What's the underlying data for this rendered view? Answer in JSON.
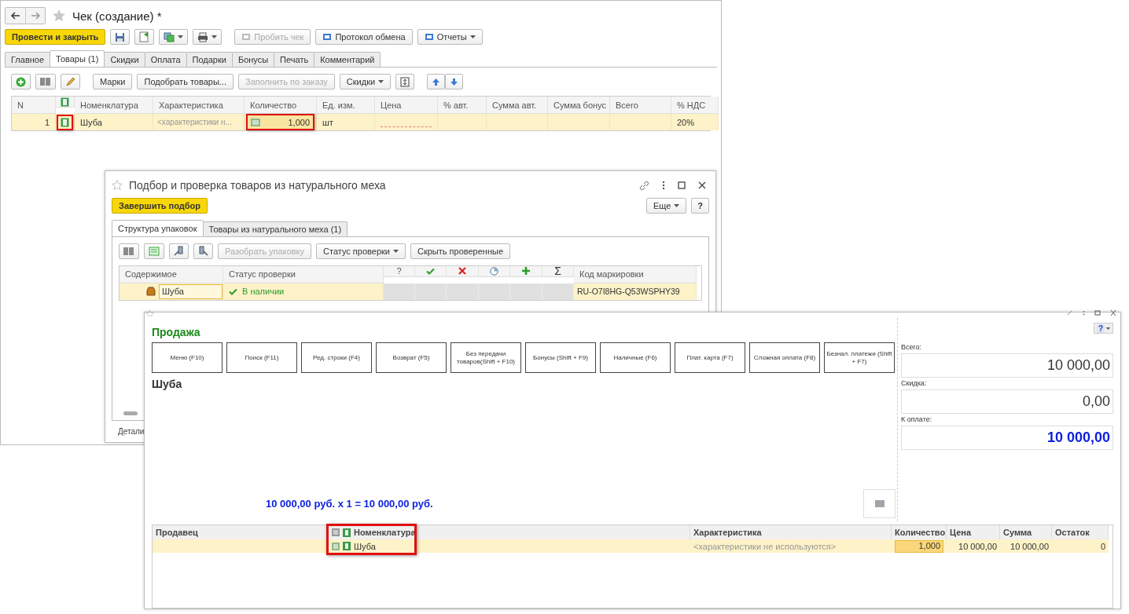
{
  "main_window": {
    "title": "Чек (создание) *",
    "primary_button": "Провести и закрыть",
    "toolbar_buttons": [
      {
        "label": "Пробить чек",
        "disabled": true,
        "dropdown": false
      },
      {
        "label": "Протокол обмена",
        "disabled": false,
        "dropdown": false
      },
      {
        "label": "Отчеты",
        "disabled": false,
        "dropdown": true
      }
    ],
    "tabs": [
      {
        "label": "Главное",
        "selected": false
      },
      {
        "label": "Товары (1)",
        "selected": true
      },
      {
        "label": "Скидки",
        "selected": false
      },
      {
        "label": "Оплата",
        "selected": false
      },
      {
        "label": "Подарки",
        "selected": false
      },
      {
        "label": "Бонусы",
        "selected": false
      },
      {
        "label": "Печать",
        "selected": false
      },
      {
        "label": "Комментарий",
        "selected": false
      }
    ],
    "table_buttons": [
      {
        "label": "Марки",
        "disabled": false,
        "dropdown": false
      },
      {
        "label": "Подобрать товары...",
        "disabled": false,
        "dropdown": false
      },
      {
        "label": "Заполнить по заказу",
        "disabled": true,
        "dropdown": false
      },
      {
        "label": "Скидки",
        "disabled": false,
        "dropdown": true
      }
    ],
    "table": {
      "columns": [
        "N",
        "Номенклатура",
        "Характеристика",
        "Количество",
        "Ед. изм.",
        "Цена",
        "% авт.",
        "Сумма авт.",
        "Сумма бонус",
        "Всего",
        "% НДС"
      ],
      "rows": [
        {
          "n": "1",
          "icon_highlighted": true,
          "nomenclature": "Шуба",
          "characteristic": "<характеристики н...",
          "quantity": "1,000",
          "quantity_highlighted": true,
          "unit": "шт",
          "vat": "20%"
        }
      ]
    }
  },
  "picking_window": {
    "title": "Подбор и проверка товаров из натурального меха",
    "finish_button": "Завершить подбор",
    "more_button": "Еще",
    "help_button": "?",
    "tabs": [
      {
        "label": "Структура упаковок",
        "selected": true
      },
      {
        "label": "Товары из натурального меха (1)",
        "selected": false
      }
    ],
    "toolbar_buttons": [
      {
        "label": "Разобрать упаковку",
        "disabled": true,
        "dropdown": false
      },
      {
        "label": "Статус проверки",
        "disabled": false,
        "dropdown": true
      },
      {
        "label": "Скрыть проверенные",
        "disabled": false,
        "dropdown": false
      }
    ],
    "columns": {
      "content": "Содержимое",
      "status": "Статус проверки",
      "unknown": "?",
      "total": "Σ",
      "code": "Код маркировки"
    },
    "rows": [
      {
        "content": "Шуба",
        "status": "В наличии",
        "code": "RU-O7I8HG-Q53WSPHY39"
      }
    ],
    "footer": "Детали"
  },
  "sale_window": {
    "title": "Продажа",
    "buttons": [
      "Меню (F10)",
      "Поиск (F11)",
      "Ред. строки (F4)",
      "Возврат (F5)",
      "Без передачи товаров(Shift + F10)",
      "Бонусы (Shift + F9)",
      "Наличные (F6)",
      "Плат. карта (F7)",
      "Сложная оплата (F8)",
      "Безнал. платежи (Shift + F7)"
    ],
    "product": "Шуба",
    "formula": "10 000,00 руб. x 1  = 10 000,00 руб.",
    "help_button": "?",
    "totals": [
      {
        "label": "Всего:",
        "value": "10 000,00",
        "kind": "plain"
      },
      {
        "label": "Скидка:",
        "value": "0,00",
        "kind": "plain"
      },
      {
        "label": "К оплате:",
        "value": "10 000,00",
        "kind": "accent"
      }
    ],
    "table": {
      "columns": [
        "Продавец",
        "Номенклатура",
        "Характеристика",
        "Количество",
        "Цена",
        "Сумма",
        "Остаток"
      ],
      "rows": [
        {
          "seller": "",
          "nomenclature": "Шуба",
          "nomenclature_highlighted": true,
          "characteristic": "<характеристики не используются>",
          "quantity": "1,000",
          "price": "10 000,00",
          "sum": "10 000,00",
          "rest": "0"
        }
      ]
    }
  }
}
